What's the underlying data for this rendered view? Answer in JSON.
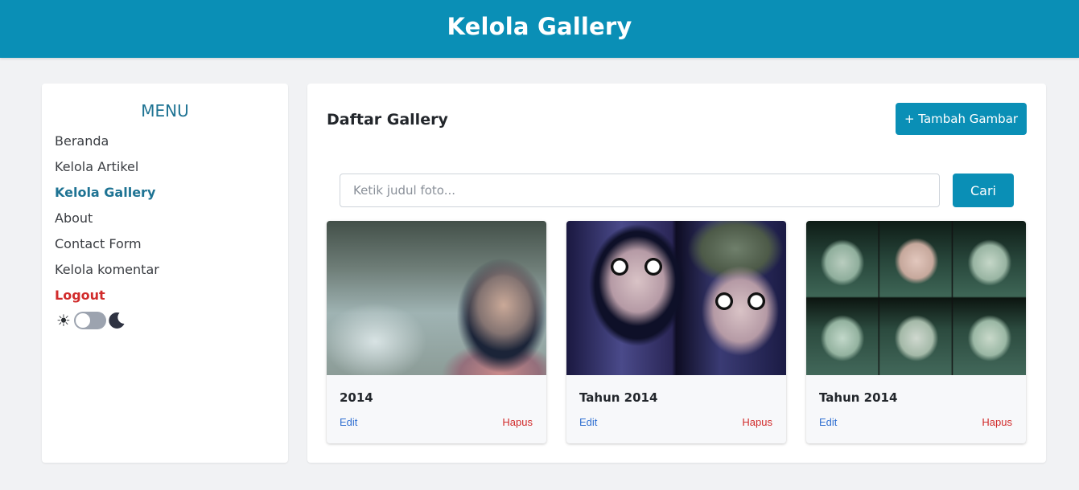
{
  "header": {
    "title": "Kelola Gallery"
  },
  "sidebar": {
    "title": "MENU",
    "items": [
      {
        "label": "Beranda"
      },
      {
        "label": "Kelola Artikel"
      },
      {
        "label": "Kelola Gallery",
        "active": true
      },
      {
        "label": "About"
      },
      {
        "label": "Contact Form"
      },
      {
        "label": "Kelola komentar"
      },
      {
        "label": "Logout"
      }
    ],
    "theme_toggle": {
      "sun": "☀",
      "dark_mode": false,
      "icons": [
        "sun-icon",
        "moon-icon"
      ]
    }
  },
  "main": {
    "title": "Daftar Gallery",
    "add_button": "+ Tambah Gambar",
    "search": {
      "placeholder": "Ketik judul foto...",
      "value": "",
      "button": "Cari"
    },
    "cards": [
      {
        "caption": "2014",
        "edit": "Edit",
        "delete": "Hapus"
      },
      {
        "caption": "Tahun 2014",
        "edit": "Edit",
        "delete": "Hapus"
      },
      {
        "caption": "Tahun 2014",
        "edit": "Edit",
        "delete": "Hapus"
      }
    ]
  },
  "colors": {
    "primary": "#0a8fb6",
    "menu_active": "#1e7393",
    "danger": "#d12b2b",
    "link": "#2f6fd1",
    "background": "#f1f2f4"
  }
}
